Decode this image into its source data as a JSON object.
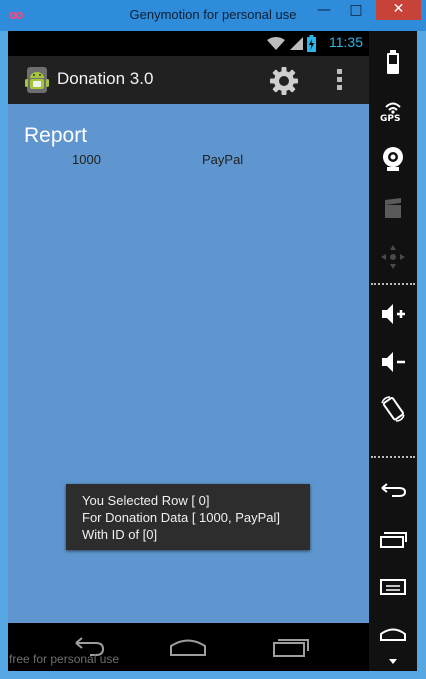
{
  "window": {
    "title": "Genymotion for personal use",
    "minimize_glyph": "—",
    "maximize_glyph": "□",
    "close_glyph": "✕",
    "watermark": "free for personal use"
  },
  "status_bar": {
    "time": "11:35",
    "icons": [
      "wifi-icon",
      "signal-icon",
      "battery-charging-icon"
    ]
  },
  "action_bar": {
    "app_icon": "android-app-icon",
    "title": "Donation 3.0",
    "actions": [
      "settings-gear-icon",
      "overflow-menu-icon"
    ]
  },
  "content": {
    "heading": "Report",
    "rows": [
      {
        "amount": "1000",
        "method": "PayPal"
      }
    ]
  },
  "toast": {
    "line1": "You Selected Row [ 0]",
    "line2": "For Donation Data [ 1000, PayPal]",
    "line3": " With ID of [0]"
  },
  "nav_bar": {
    "buttons": [
      "back-icon",
      "home-icon",
      "recent-apps-icon"
    ]
  },
  "side_panel": {
    "buttons": [
      "battery-icon",
      "gps-icon",
      "camera-icon",
      "video-icon",
      "dpad-icon",
      "volume-up-icon",
      "volume-down-icon",
      "rotate-icon",
      "back-icon",
      "recent-apps-icon",
      "menu-icon",
      "home-icon",
      "scroll-down-icon"
    ],
    "gps_label": "GPS"
  },
  "colors": {
    "window_frame": "#2f8cdb",
    "close_button": "#c7433a",
    "content_background": "#5f96cf",
    "time_color": "#30b4e8",
    "action_bar": "#212121",
    "toast_background": "#2d2d2d"
  }
}
